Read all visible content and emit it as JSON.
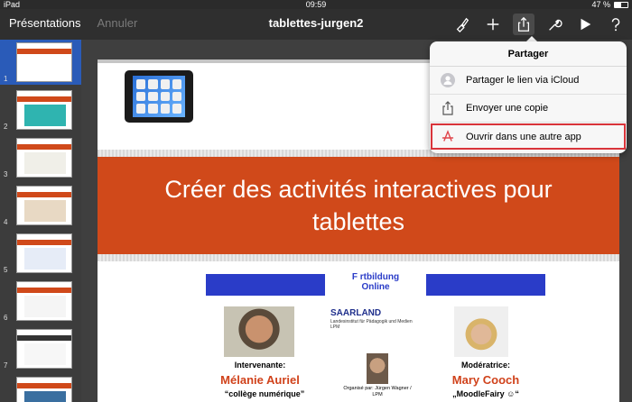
{
  "status": {
    "device": "iPad",
    "time": "09:59",
    "battery_text": "47 %",
    "battery_level": 0.47
  },
  "toolbar": {
    "back_label": "Présentations",
    "undo_label": "Annuler",
    "title": "tablettes-jurgen2"
  },
  "navigator": {
    "slides": [
      {
        "number": "1"
      },
      {
        "number": "2"
      },
      {
        "number": "3"
      },
      {
        "number": "4"
      },
      {
        "number": "5"
      },
      {
        "number": "6"
      },
      {
        "number": "7"
      },
      {
        "number": "8"
      }
    ],
    "selected": 1
  },
  "slide": {
    "title": "Créer des activités interactives pour tablettes",
    "flyer": {
      "brand_line1": "F rtbildung",
      "brand_line2": "Online",
      "saarland": "SAARLAND",
      "saarland_sub": "Landesinstitut für Pädagogik und Medien LPM",
      "speaker_role": "Intervenante:",
      "speaker_name": "Mélanie Auriel",
      "speaker_org": "“collège numérique”",
      "organizer": "Organisé par: Jürgen Wagner / LPM",
      "moderator_role": "Modératrice:",
      "moderator_name": "Mary Cooch",
      "moderator_alias": "„MoodleFairy ☺“"
    }
  },
  "share_popover": {
    "title": "Partager",
    "items": [
      {
        "label": "Partager le lien via iCloud",
        "icon": "person-icon"
      },
      {
        "label": "Envoyer une copie",
        "icon": "share-icon"
      },
      {
        "label": "Ouvrir dans une autre app",
        "icon": "app-store-icon",
        "highlighted": true
      }
    ]
  },
  "colors": {
    "accent_orange": "#d0491a",
    "selection_blue": "#2a5bb8",
    "highlight_red": "#d9343a"
  }
}
